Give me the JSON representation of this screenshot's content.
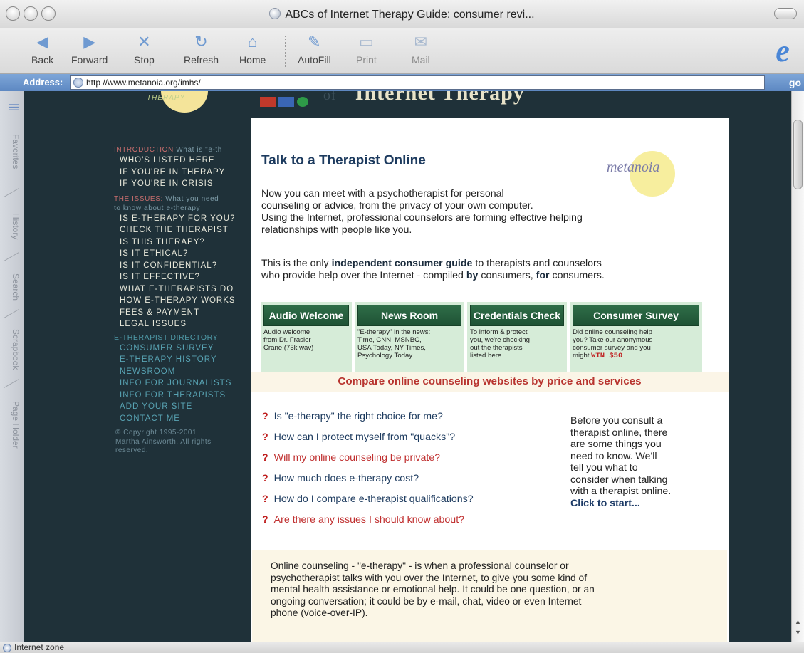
{
  "window": {
    "title": "ABCs of Internet Therapy Guide: consumer revi..."
  },
  "toolbar": {
    "back": "Back",
    "forward": "Forward",
    "stop": "Stop",
    "refresh": "Refresh",
    "home": "Home",
    "autofill": "AutoFill",
    "print": "Print",
    "mail": "Mail"
  },
  "address": {
    "label": "Address:",
    "url": "http //www.metanoia.org/imhs/",
    "go": "go"
  },
  "sidetabs": [
    "Favorites",
    "History",
    "Search",
    "Scrapbook",
    "Page Holder"
  ],
  "status": {
    "zone": "Internet zone"
  },
  "header": {
    "logo_fragment": "THERAPY",
    "banner_of": "of",
    "banner_title": "\"Internet Therapy\""
  },
  "nav": {
    "intro_label": "INTRODUCTION",
    "intro_sub": "What is \"e-th",
    "intro_items": [
      "WHO'S LISTED HERE",
      "IF YOU'RE IN THERAPY",
      "IF YOU'RE IN CRISIS"
    ],
    "issues_label": "THE ISSUES:",
    "issues_sub": "What you need",
    "issues_sub2": "to know about e-therapy",
    "issues_items": [
      "IS E-THERAPY FOR YOU?",
      "CHECK THE THERAPIST",
      "IS THIS THERAPY?",
      "IS IT ETHICAL?",
      "IS IT CONFIDENTIAL?",
      "IS IT EFFECTIVE?",
      "WHAT E-THERAPISTS DO",
      "HOW E-THERAPY WORKS",
      "FEES & PAYMENT",
      "LEGAL ISSUES"
    ],
    "directory_label": "E-THERAPIST DIRECTORY",
    "directory_items": [
      "CONSUMER SURVEY",
      "E-THERAPY HISTORY",
      "NEWSROOM",
      "INFO FOR JOURNALISTS",
      "INFO FOR THERAPISTS",
      "ADD YOUR SITE",
      "CONTACT ME"
    ],
    "copyright_line1": "© Copyright 1995-2001",
    "copyright_line2": "Martha Ainsworth. All rights",
    "copyright_line3": "reserved."
  },
  "main": {
    "headline": "Talk to a Therapist Online",
    "badge": "metanoia",
    "intro_1": "Now you can meet with a psychotherapist for personal",
    "intro_2": "counseling or advice, from the privacy of your own computer.",
    "intro_3": "Using the Internet, professional counselors are forming effective helping",
    "intro_4": "relationships with people like you.",
    "guide_a": "This is the only ",
    "guide_b": "independent consumer guide",
    "guide_c": " to therapists and counselors",
    "guide_d": "who provide help over the Internet - compiled ",
    "guide_e": "by",
    "guide_f": " consumers, ",
    "guide_g": "for",
    "guide_h": " consumers.",
    "cards": [
      {
        "title": "Audio Welcome",
        "lines": [
          "Audio welcome",
          "from Dr. Frasier",
          "Crane (75k wav)"
        ]
      },
      {
        "title": "News Room",
        "lines": [
          "\"E-therapy\" in the news:",
          "Time, CNN, MSNBC,",
          "USA Today, NY Times,",
          "Psychology Today..."
        ]
      },
      {
        "title": "Credentials Check",
        "lines": [
          "To inform & protect",
          "you, we're checking",
          "out the therapists",
          "listed here."
        ]
      },
      {
        "title": "Consumer Survey",
        "lines": [
          "Did online counseling help",
          "you? Take our anonymous",
          "consumer survey and you",
          "might "
        ],
        "win": "WIN $50"
      }
    ],
    "compare": "Compare online counseling websites by price and services",
    "faq": [
      {
        "q": "?",
        "text": "Is \"e-therapy\" the right choice for me?"
      },
      {
        "q": "?",
        "text": "How can I protect myself from \"quacks\"?"
      },
      {
        "q": "?",
        "text": "Will my online counseling be private?"
      },
      {
        "q": "?",
        "text": "How much does e-therapy cost?"
      },
      {
        "q": "?",
        "text": "How do I compare e-therapist qualifications?"
      },
      {
        "q": "?",
        "text": "Are there any issues I should know about?"
      }
    ],
    "aside_lines": [
      "Before you consult a",
      "therapist online, there",
      "are some things you",
      "need to know. We'll",
      "tell you what to",
      "consider when talking",
      "with a therapist online."
    ],
    "aside_cta": "Click to start...",
    "explain": [
      "Online counseling - \"e-therapy\" - is when a professional counselor or",
      "psychotherapist talks with you over the Internet, to give you some kind of",
      "mental health assistance or emotional help. It could be one question, or an",
      "ongoing conversation; it could be by e-mail, chat, video or even Internet",
      "phone (voice-over-IP)."
    ]
  },
  "colors": {
    "page_background": "#1f3139",
    "card_header": "#1e5234",
    "card_body": "#d6ecd8",
    "compare_text": "#b8342f",
    "headline": "#1c3a5e"
  }
}
